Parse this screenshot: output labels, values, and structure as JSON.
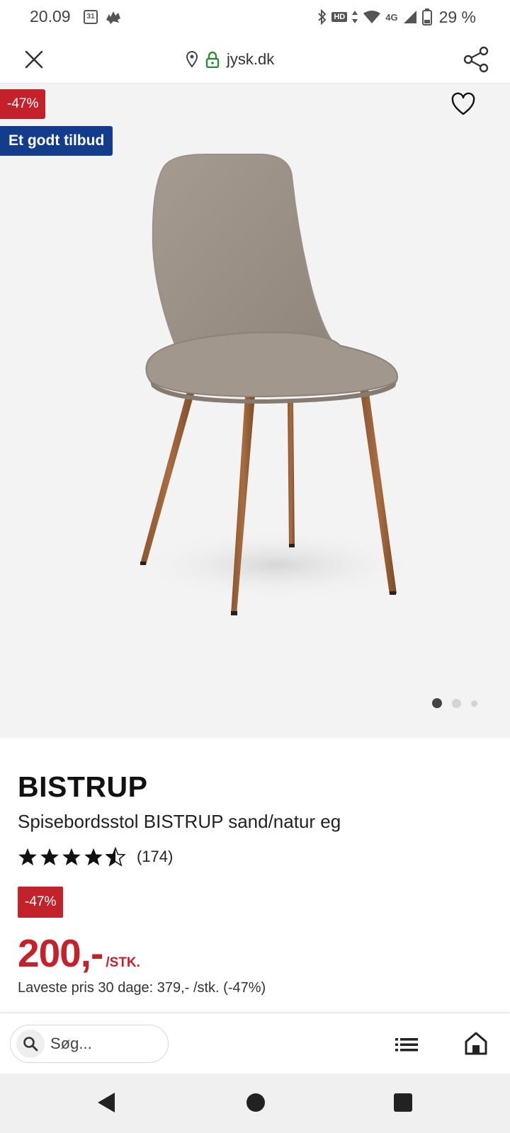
{
  "status_bar": {
    "time": "20.09",
    "calendar_day": "31",
    "battery": "29 %",
    "network": "4G",
    "hd": "HD"
  },
  "browser": {
    "url": "jysk.dk"
  },
  "hero": {
    "discount_badge": "-47%",
    "offer_badge": "Et godt tilbud",
    "image_count": 3,
    "active_image": 1
  },
  "product": {
    "brand": "BISTRUP",
    "title": "Spisebordsstol BISTRUP sand/natur eg",
    "rating": 4.5,
    "review_count": "(174)",
    "discount_badge": "-47%",
    "price": "200,-",
    "unit": "/STK.",
    "lowest_price": "Laveste pris 30 dage: 379,- /stk. (-47%)"
  },
  "bottom_bar": {
    "search_placeholder": "Søg..."
  },
  "colors": {
    "accent_red": "#c3222b",
    "offer_blue": "#143c8c",
    "secure_green": "#2e8b3a"
  }
}
